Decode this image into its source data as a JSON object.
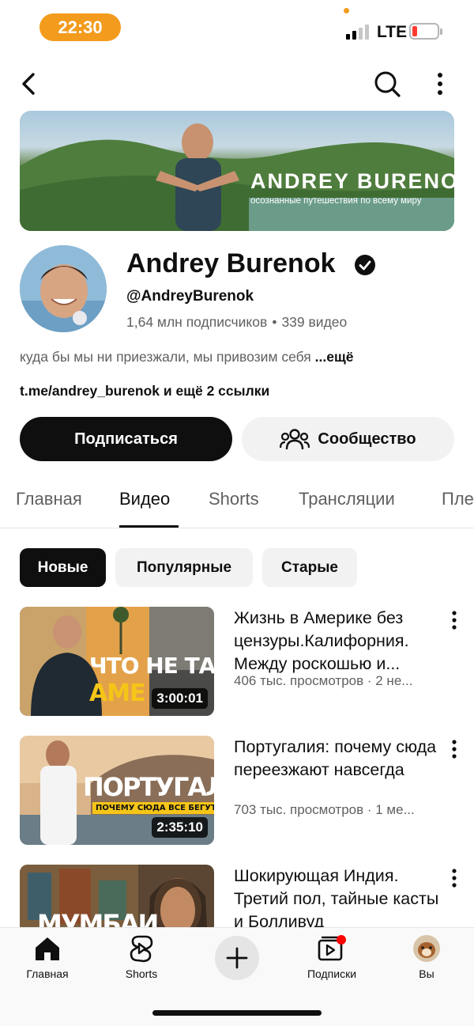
{
  "status_bar": {
    "time": "22:30",
    "network": "LTE"
  },
  "banner": {
    "title": "ANDREY BURENOK",
    "subtitle": "осознанные путешествия по всему миру"
  },
  "channel": {
    "name": "Andrey Burenok",
    "handle": "@AndreyBurenok",
    "subscribers": "1,64 млн подписчиков",
    "separator": "•",
    "videos_count": "339 видео",
    "description": "куда бы мы ни приезжали, мы привозим себя",
    "description_more": "...ещё",
    "links": "t.me/andrey_burenok и ещё 2 ссылки"
  },
  "buttons": {
    "subscribe": "Подписаться",
    "community": "Сообщество"
  },
  "tabs": [
    {
      "label": "Главная"
    },
    {
      "label": "Видео"
    },
    {
      "label": "Shorts"
    },
    {
      "label": "Трансляции"
    },
    {
      "label": "Пле"
    }
  ],
  "active_tab": "Видео",
  "chips": [
    {
      "label": "Новые"
    },
    {
      "label": "Популярные"
    },
    {
      "label": "Старые"
    }
  ],
  "videos": [
    {
      "title": "Жизнь в Америке без цензуры.Калифорния. Между роскошью и...",
      "meta": "406 тыс. просмотров · 2 не...",
      "duration": "3:00:01",
      "thumb_line1": "ЧТО НЕ ТАК С",
      "thumb_line2": "АМЕРИКОЙ"
    },
    {
      "title": "Португалия: почему сюда переезжают навсегда",
      "meta": "703 тыс. просмотров · 1 ме...",
      "duration": "2:35:10",
      "thumb_line1": "ПОРТУГАЛИЯ",
      "thumb_line2": "ПОЧЕМУ СЮДА ВСЕ БЕГУТ?"
    },
    {
      "title": "Шокирующая Индия. Третий пол, тайные касты и Болливуд",
      "thumb_line1": "МУМБАИ"
    }
  ],
  "bottom_nav": [
    {
      "label": "Главная",
      "icon": "home-icon"
    },
    {
      "label": "Shorts",
      "icon": "shorts-icon"
    },
    {
      "label": "",
      "icon": "plus-icon"
    },
    {
      "label": "Подписки",
      "icon": "subscriptions-icon"
    },
    {
      "label": "Вы",
      "icon": "avatar"
    }
  ],
  "colors": {
    "accent_orange": "#f39b1d",
    "primary_text": "#0f0f0f",
    "secondary_text": "#606060",
    "chip_bg": "#f2f2f2",
    "notification_red": "#ff0000"
  }
}
